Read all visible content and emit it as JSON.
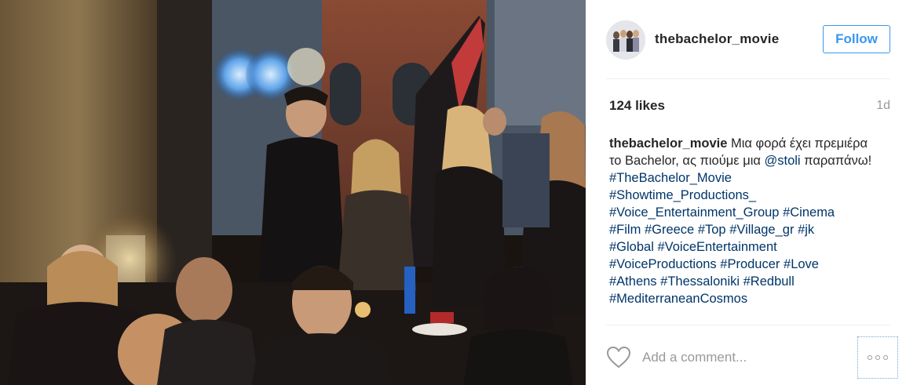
{
  "post": {
    "photo_alt": "",
    "username": "thebachelor_movie",
    "follow_label": "Follow",
    "likes": "124 likes",
    "time": "1d"
  },
  "caption": {
    "username": "thebachelor_movie",
    "text_1": " Μια φορά έχει πρεμιέρα το Bachelor, ας πιούμε μια ",
    "mention": "@stoli",
    "text_2": " παραπάνω!",
    "hashtags": [
      "#TheBachelor_Movie",
      "#Showtime_Productions_",
      "#Voice_Entertainment_Group",
      "#Cinema",
      "#Film",
      "#Greece",
      "#Top",
      "#Village_gr",
      "#jk",
      "#Global",
      "#VoiceEntertainment",
      "#VoiceProductions",
      "#Producer",
      "#Love",
      "#Athens",
      "#Thessaloniki",
      "#Redbull",
      "#MediterraneanCosmos"
    ]
  },
  "comment": {
    "placeholder": "Add a comment..."
  },
  "colors": {
    "accent": "#3897f0",
    "link": "#003569",
    "muted": "#999999"
  },
  "icons": {
    "like": "heart-outline-icon",
    "more": "more-options-icon"
  }
}
